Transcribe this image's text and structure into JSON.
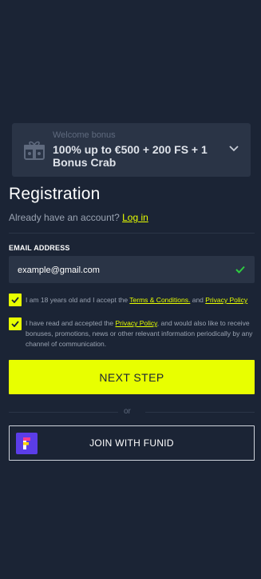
{
  "bonus": {
    "small_label": "Welcome bonus",
    "offer": "100% up to €500 + 200 FS + 1 Bonus Crab"
  },
  "registration": {
    "title": "Registration",
    "have_account": "Already have an account?",
    "login_link": "Log in"
  },
  "email": {
    "label": "EMAIL ADDRESS",
    "value": "example@gmail.com"
  },
  "consents": {
    "age_prefix": "I am 18 years old and I accept the",
    "terms_link": "Terms & Conditions.",
    "and": "and",
    "privacy_link": "Privacy Policy",
    "marketing_prefix": "I have read and accepted the",
    "marketing_link": "Privacy Policy",
    "marketing_suffix": ", and would also like to receive bonuses, promotions, news or other relevant information periodically by any channel of communication."
  },
  "actions": {
    "next_step": "NEXT STEP",
    "or": "or",
    "funid": "JOIN WITH FUNID"
  },
  "colors": {
    "accent": "#e8ff00",
    "background": "#1b2435",
    "panel": "#2a3446",
    "check": "#2ecc40",
    "funid_logo": "#5b3de8"
  }
}
